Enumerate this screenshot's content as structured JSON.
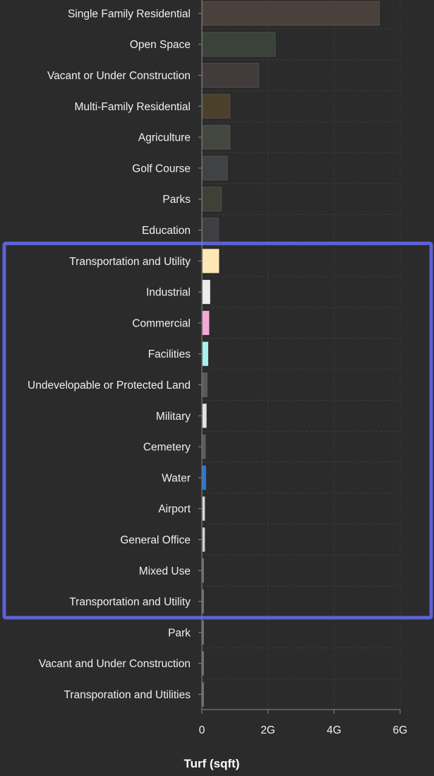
{
  "chart_data": {
    "type": "bar",
    "orientation": "horizontal",
    "xlabel": "Turf (sqft)",
    "ylabel": "",
    "xlim": [
      0,
      6000000000
    ],
    "x_ticks": [
      0,
      2000000000,
      4000000000,
      6000000000
    ],
    "x_tick_labels": [
      "0",
      "2G",
      "4G",
      "6G"
    ],
    "grid": true,
    "categories": [
      "Single Family Residential",
      "Open Space",
      "Vacant or Under Construction",
      "Multi-Family Residential",
      "Agriculture",
      "Golf Course",
      "Parks",
      "Education",
      "Transportation and Utility",
      "Industrial",
      "Commercial",
      "Facilities",
      "Undevelopable or Protected Land",
      "Military",
      "Cemetery",
      "Water",
      "Airport",
      "General Office",
      "Mixed Use",
      "Transportation and Utility",
      "Park",
      "Vacant and Under Construction",
      "Transporation and Utilities"
    ],
    "values": [
      5350000000,
      2200000000,
      1700000000,
      830000000,
      830000000,
      750000000,
      570000000,
      480000000,
      500000000,
      230000000,
      200000000,
      170000000,
      140000000,
      120000000,
      90000000,
      100000000,
      70000000,
      70000000,
      8000000,
      6000000,
      4000000,
      3000000,
      2000000
    ],
    "colors": [
      "#4a413c",
      "#3a4239",
      "#413b3b",
      "#4b412b",
      "#434740",
      "#404243",
      "#3f4136",
      "#3d3f43",
      "#ffe7b5",
      "#ececec",
      "#f5a9d8",
      "#a8f1ee",
      "#5a5a5a",
      "#e3e3e3",
      "#5a5a5a",
      "#1f7be0",
      "#d8d8d8",
      "#d0d0d0",
      "#777777",
      "#777777",
      "#777777",
      "#777777",
      "#777777"
    ],
    "highlight": {
      "from_index": 8,
      "to_index": 19,
      "color": "#5b62d6"
    }
  }
}
